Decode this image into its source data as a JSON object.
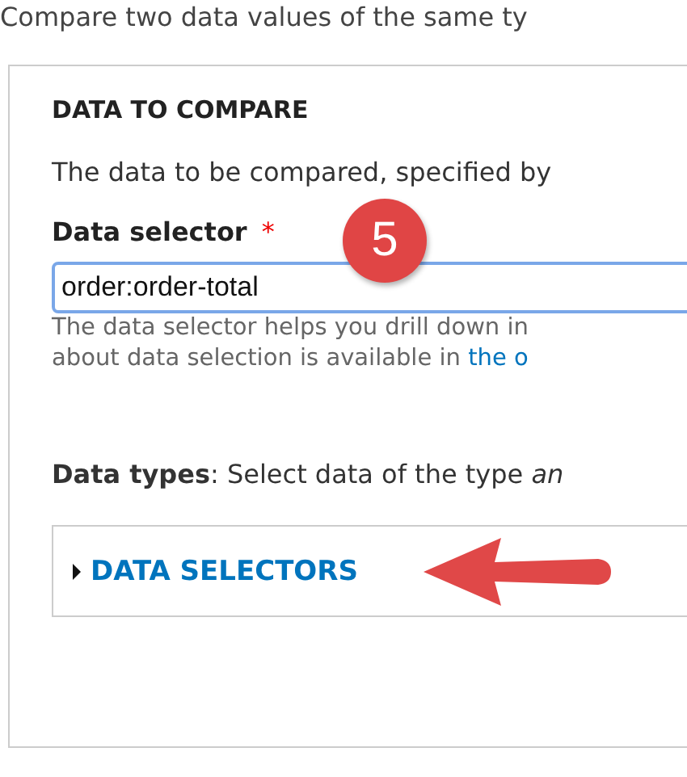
{
  "intro": "Compare two data values of the same ty",
  "fieldset": {
    "legend": "DATA TO COMPARE",
    "description": "The data to be compared, specified by",
    "field": {
      "label": "Data selector",
      "required": true,
      "required_mark": "*",
      "value": "order:order-total"
    },
    "help_lines": [
      "The data selector helps you drill down in"
    ],
    "help_last": {
      "text": "about data selection is available in ",
      "link": "the o"
    },
    "data_types": "**Data types**: Select data of the type *an*",
    "details": {
      "summary": "DATA SELECTORS",
      "expanded": false
    }
  },
  "callout": {
    "number": "5"
  }
}
